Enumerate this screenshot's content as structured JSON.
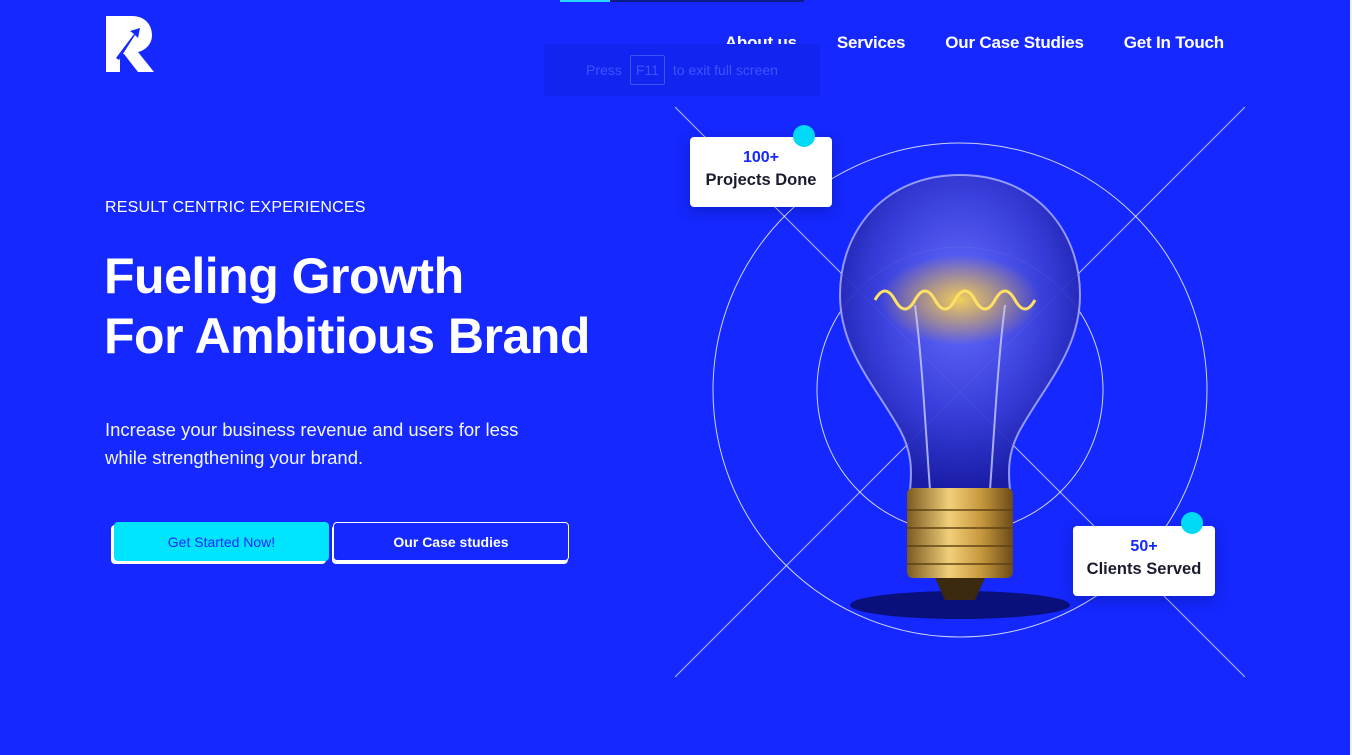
{
  "colors": {
    "background": "#1428ff",
    "accent": "#00e5ff",
    "white": "#ffffff",
    "stat_number": "#1428ff"
  },
  "header": {
    "logo_icon": "r-arrow-logo",
    "nav": [
      "About us",
      "Services",
      "Our Case Studies",
      "Get In Touch"
    ]
  },
  "fullscreen_hint": {
    "press": "Press",
    "key": "F11",
    "rest": "to exit full screen"
  },
  "hero": {
    "eyebrow": "RESULT CENTRIC EXPERIENCES",
    "headline_line1": "Fueling Growth",
    "headline_line2": "For Ambitious Brand",
    "subcopy": "Increase your business revenue and users for less while strengthening your brand.",
    "primary_cta": "Get Started Now!",
    "secondary_cta": "Our Case studies"
  },
  "stats": [
    {
      "number": "100+",
      "label": "Projects Done"
    },
    {
      "number": "50+",
      "label": "Clients Served"
    }
  ],
  "illustration_icon": "light-bulb-icon"
}
